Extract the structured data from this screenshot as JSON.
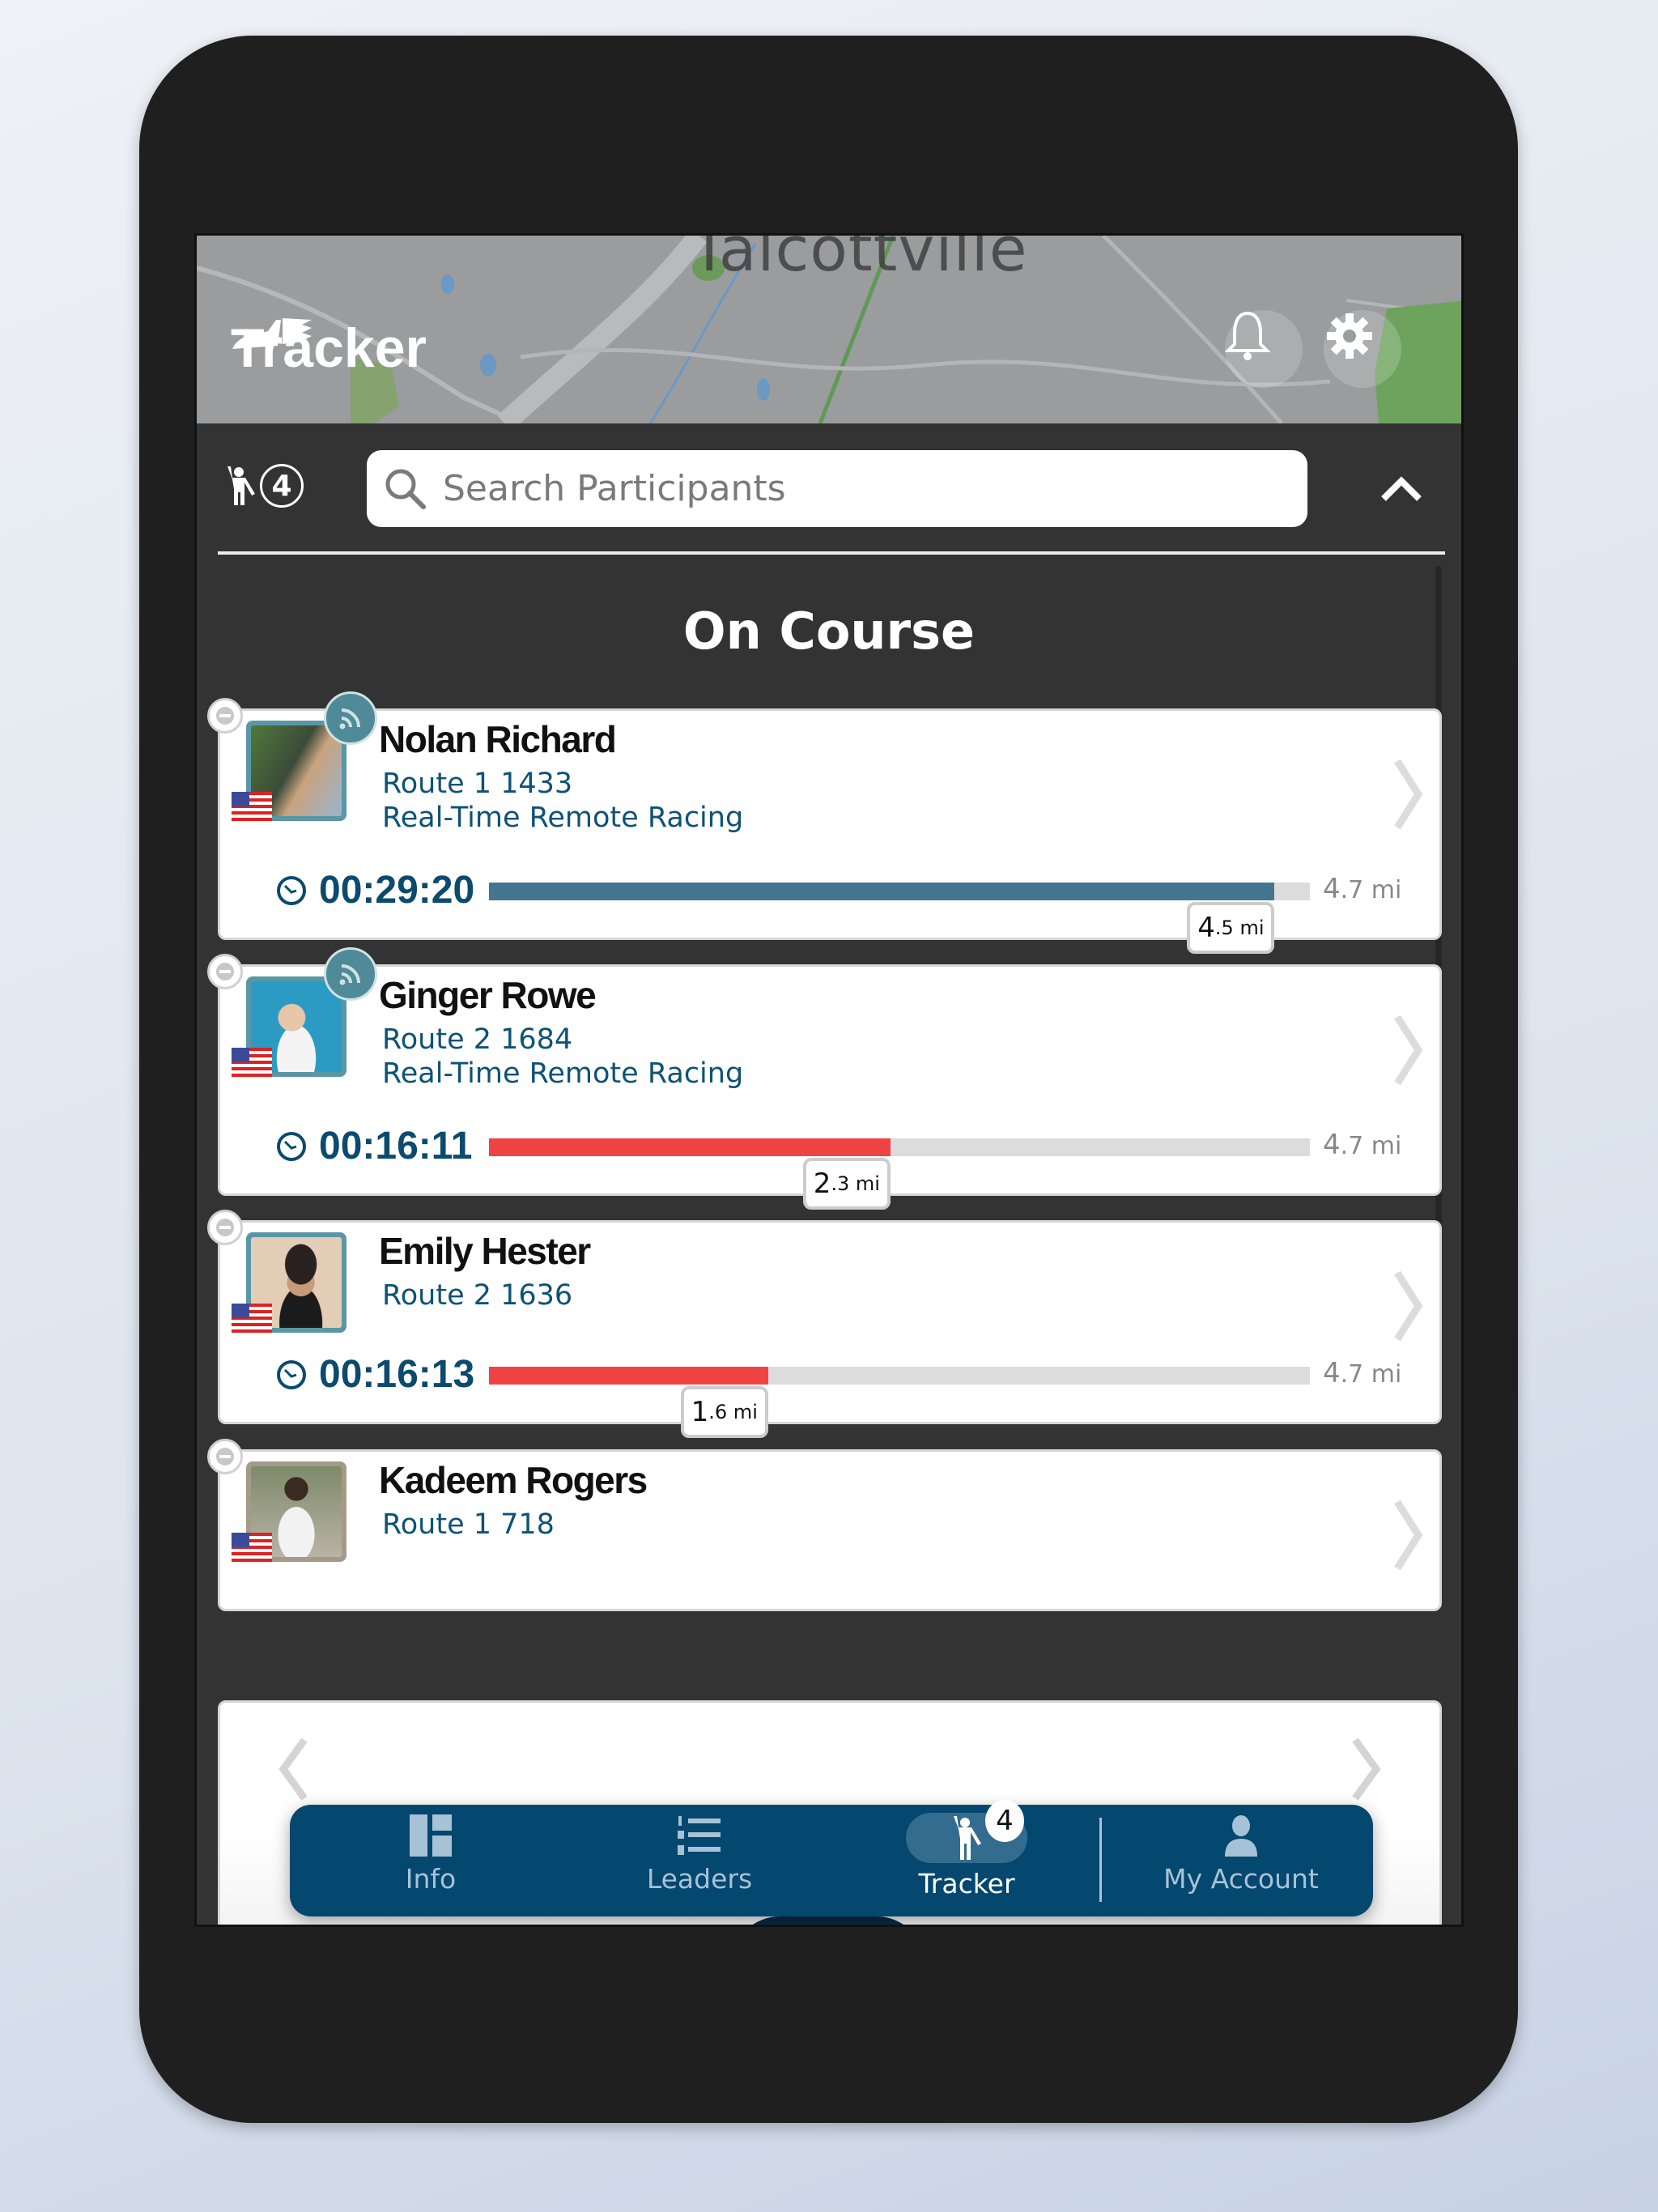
{
  "header": {
    "title": "Tracker",
    "map_place_label": "Talcottville",
    "logo_icon": "winged-shoe-icon",
    "notifications_icon": "bell-icon",
    "settings_icon": "gear-icon"
  },
  "search": {
    "participant_count": "4",
    "participant_icon": "waving-person-icon",
    "placeholder": "Search Participants",
    "value": "",
    "collapse_icon": "chevron-up-icon"
  },
  "section_title": "On Course",
  "participants": [
    {
      "name": "Nolan Richard",
      "route": "Route 1 1433",
      "mode": "Real-Time Remote Racing",
      "live": true,
      "country_flag": "us-flag",
      "elapsed": "00:29:20",
      "distance_done_int": "4",
      "distance_done_dec": ".5 mi",
      "distance_total_int": "4",
      "distance_total_dec": ".7 mi",
      "progress": 0.957,
      "bar_color": "#467592",
      "avatar_color": "#6a8a5a"
    },
    {
      "name": "Ginger Rowe",
      "route": "Route 2 1684",
      "mode": "Real-Time Remote Racing",
      "live": true,
      "country_flag": "us-flag",
      "elapsed": "00:16:11",
      "distance_done_int": "2",
      "distance_done_dec": ".3 mi",
      "distance_total_int": "4",
      "distance_total_dec": ".7 mi",
      "progress": 0.489,
      "bar_color": "#f04444",
      "avatar_color": "#2b9bc4"
    },
    {
      "name": "Emily Hester",
      "route": "Route 2 1636",
      "mode": "",
      "live": false,
      "country_flag": "us-flag",
      "elapsed": "00:16:13",
      "distance_done_int": "1",
      "distance_done_dec": ".6 mi",
      "distance_total_int": "4",
      "distance_total_dec": ".7 mi",
      "progress": 0.34,
      "bar_color": "#f04444",
      "avatar_color": "#d9b8a0"
    },
    {
      "name": "Kadeem Rogers",
      "route": "Route 1 718",
      "mode": "",
      "live": false,
      "country_flag": "us-flag",
      "avatar_color": "#8a8e7a"
    }
  ],
  "carousel": {
    "prev_icon": "chevron-left-icon",
    "next_icon": "chevron-right-icon"
  },
  "nav": {
    "items": [
      {
        "label": "Info",
        "icon": "dashboard-icon",
        "active": false
      },
      {
        "label": "Leaders",
        "icon": "ranked-list-icon",
        "active": false
      },
      {
        "label": "Tracker",
        "icon": "waving-person-icon",
        "active": true,
        "badge": "4"
      },
      {
        "label": "My Account",
        "icon": "user-icon",
        "active": false
      }
    ]
  },
  "colors": {
    "brand_blue": "#04476f",
    "text_blue": "#0c4a6e",
    "leader_bar": "#467592",
    "trailing_bar": "#f04444",
    "panel_bg": "#333333"
  }
}
